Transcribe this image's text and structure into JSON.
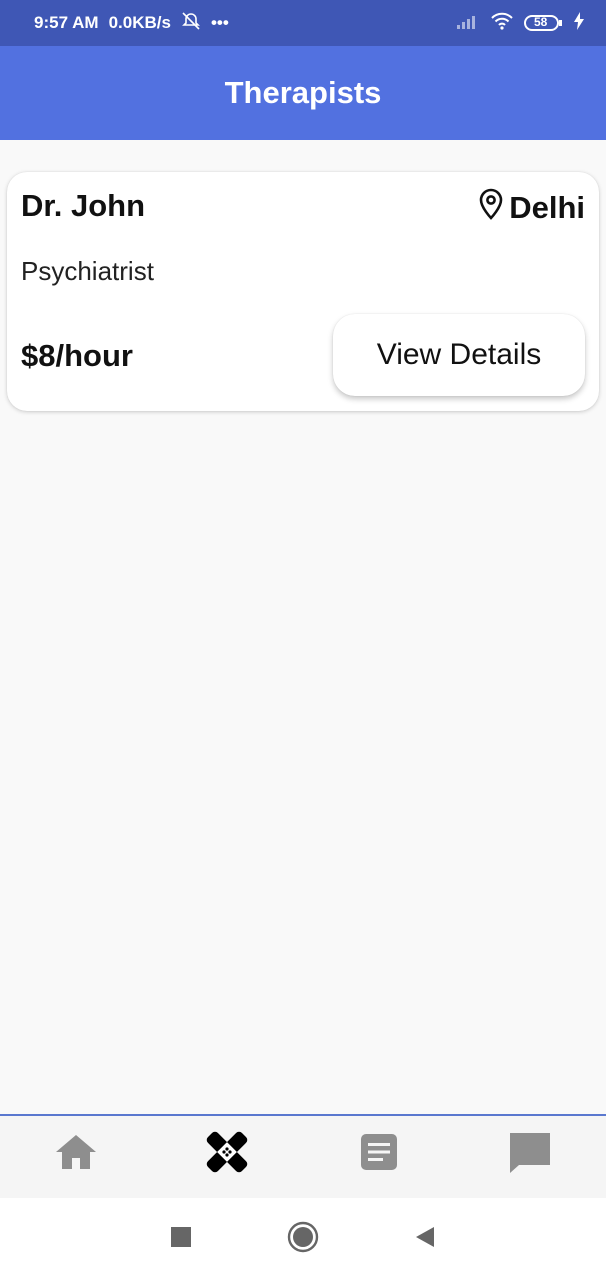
{
  "status_bar": {
    "time": "9:57 AM",
    "speed": "0.0KB/s",
    "more": "•••",
    "battery": "58"
  },
  "app_bar": {
    "title": "Therapists"
  },
  "therapists": [
    {
      "name": "Dr. John",
      "location": "Delhi",
      "specialty": "Psychiatrist",
      "rate": "$8/hour",
      "button_label": "View Details"
    }
  ],
  "bottom_nav": {
    "items": [
      {
        "icon": "home-icon",
        "active": false
      },
      {
        "icon": "bandage-icon",
        "active": true
      },
      {
        "icon": "document-icon",
        "active": false
      },
      {
        "icon": "chat-icon",
        "active": false
      }
    ]
  },
  "colors": {
    "status_bar": "#3f57b5",
    "app_bar": "#5271e0",
    "nav_inactive": "#8e8e8e",
    "nav_active": "#000000"
  }
}
